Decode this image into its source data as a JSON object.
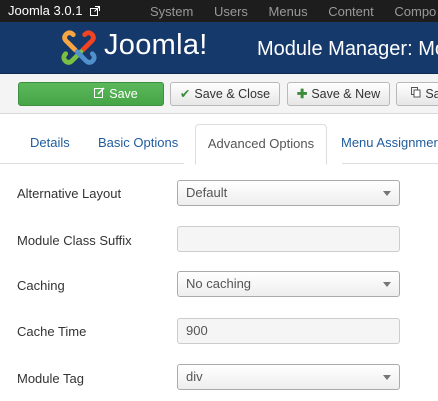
{
  "topbar": {
    "brand": "Joomla 3.0.1",
    "menu": [
      "System",
      "Users",
      "Menus",
      "Content",
      "Compo"
    ]
  },
  "header": {
    "logo_text": "Joomla!",
    "title": "Module Manager: Mo"
  },
  "toolbar": {
    "save_label": "Save",
    "save_close_label": "Save & Close",
    "save_new_label": "Save & New",
    "copy_label": "Sa"
  },
  "tabs": {
    "details": "Details",
    "basic": "Basic Options",
    "advanced": "Advanced Options",
    "menu": "Menu Assignmer"
  },
  "form": {
    "alt_layout": {
      "label": "Alternative Layout",
      "value": "Default"
    },
    "class_suffix": {
      "label": "Module Class Suffix",
      "value": ""
    },
    "caching": {
      "label": "Caching",
      "value": "No caching"
    },
    "cache_time": {
      "label": "Cache Time",
      "value": "900"
    },
    "module_tag": {
      "label": "Module Tag",
      "value": "div"
    }
  },
  "colors": {
    "header_bg": "#16396b",
    "save_green": "#46a546",
    "link_blue": "#1f5c9e"
  }
}
